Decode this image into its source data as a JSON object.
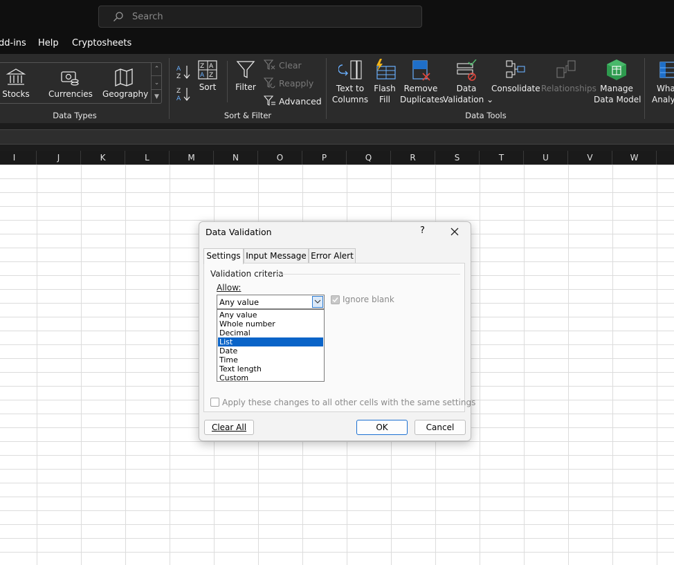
{
  "titlebar": {
    "search_placeholder": "Search"
  },
  "menu": {
    "items": [
      "dd-ins",
      "Help",
      "Cryptosheets"
    ]
  },
  "ribbon": {
    "data_types": {
      "stocks": "Stocks",
      "currencies": "Currencies",
      "geography": "Geography",
      "group_label": "Data Types"
    },
    "sort_filter": {
      "sort": "Sort",
      "filter": "Filter",
      "clear": "Clear",
      "reapply": "Reapply",
      "advanced": "Advanced",
      "group_label": "Sort & Filter"
    },
    "data_tools": {
      "text_to_columns_1": "Text to",
      "text_to_columns_2": "Columns",
      "flash_fill_1": "Flash",
      "flash_fill_2": "Fill",
      "remove_dup_1": "Remove",
      "remove_dup_2": "Duplicates",
      "data_val_1": "Data",
      "data_val_2": "Validation",
      "consolidate": "Consolidate",
      "relationships": "Relationships",
      "manage_1": "Manage",
      "manage_2": "Data Model",
      "whatif_1": "What-",
      "whatif_2": "Analys",
      "group_label": "Data Tools"
    }
  },
  "columns": [
    "I",
    "J",
    "K",
    "L",
    "M",
    "N",
    "O",
    "P",
    "Q",
    "R",
    "S",
    "T",
    "U",
    "V",
    "W"
  ],
  "dialog": {
    "title": "Data Validation",
    "help": "?",
    "tabs": [
      "Settings",
      "Input Message",
      "Error Alert"
    ],
    "validation_criteria": "Validation criteria",
    "allow_label": "Allow:",
    "allow_value": "Any value",
    "options": [
      "Any value",
      "Whole number",
      "Decimal",
      "List",
      "Date",
      "Time",
      "Text length",
      "Custom"
    ],
    "highlighted_option": "List",
    "ignore_blank": "Ignore blank",
    "apply_all": "Apply these changes to all other cells with the same settings",
    "clear_all": "Clear All",
    "ok": "OK",
    "cancel": "Cancel"
  },
  "colors": {
    "accent": "#0a64c8",
    "ribbon_bg": "#2b2b2b",
    "titlebar_bg": "#0f0f0f"
  }
}
